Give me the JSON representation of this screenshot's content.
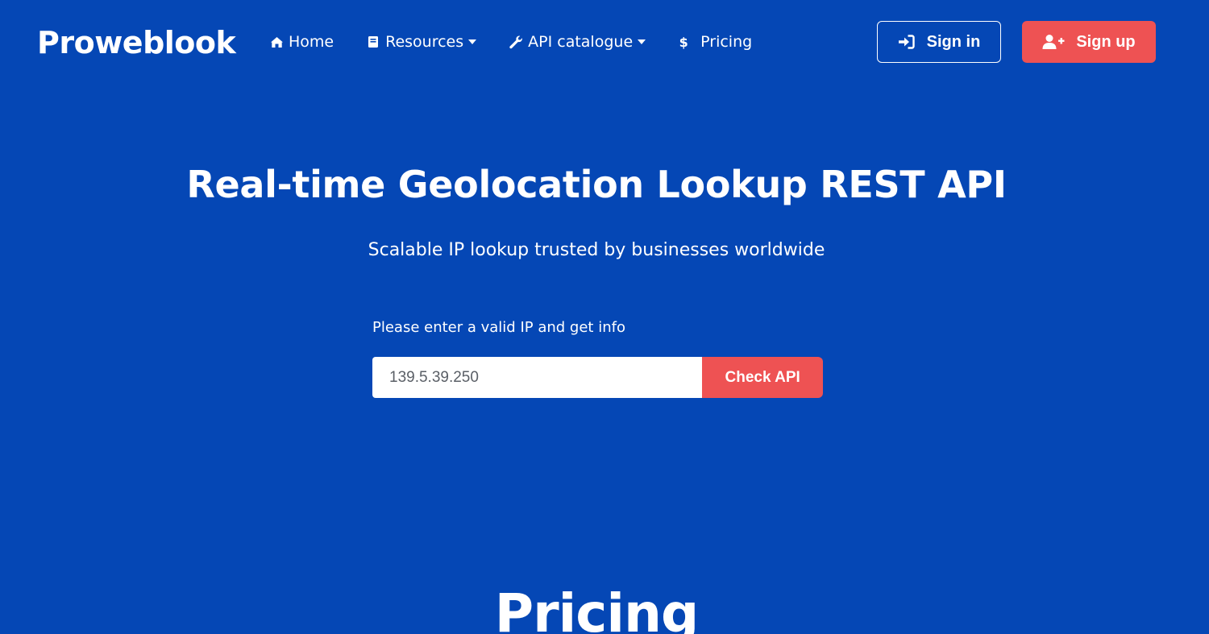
{
  "brand": {
    "name": "Proweblook"
  },
  "nav": {
    "home": {
      "label": "Home",
      "icon": "home-icon"
    },
    "resources": {
      "label": "Resources",
      "icon": "book-icon"
    },
    "api_catalogue": {
      "label": "API catalogue",
      "icon": "wrench-icon"
    },
    "pricing": {
      "label": "Pricing",
      "icon": "dollar-icon"
    }
  },
  "auth": {
    "sign_in": {
      "label": "Sign in",
      "icon": "sign-in-icon"
    },
    "sign_up": {
      "label": "Sign up",
      "icon": "user-plus-icon"
    }
  },
  "hero": {
    "title": "Real-time Geolocation Lookup REST API",
    "subtitle": "Scalable IP lookup trusted by businesses worldwide"
  },
  "ip_lookup": {
    "label": "Please enter a valid IP and get info",
    "value": "139.5.39.250",
    "button_label": "Check API"
  },
  "pricing": {
    "heading": "Pricing"
  },
  "colors": {
    "background": "#0547b5",
    "accent": "#ee5253",
    "text": "#ffffff"
  }
}
